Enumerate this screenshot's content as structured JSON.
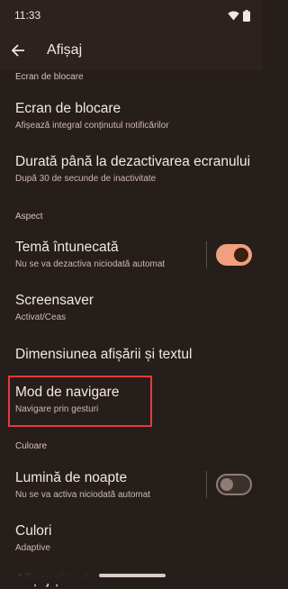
{
  "status": {
    "time": "11:33"
  },
  "appbar": {
    "title": "Afișaj"
  },
  "sections": {
    "lock": "Ecran de blocare",
    "aspect": "Aspect",
    "culoare": "Culoare"
  },
  "items": {
    "lockscreen": {
      "title": "Ecran de blocare",
      "sub": "Afișează integral conținutul notificărilor"
    },
    "timeout": {
      "title": "Durată până la dezactivarea ecranului",
      "sub": "După 30 de secunde de inactivitate"
    },
    "dark": {
      "title": "Temă întunecată",
      "sub": "Nu se va dezactiva niciodată automat",
      "enabled": true
    },
    "screensaver": {
      "title": "Screensaver",
      "sub": "Activat/Ceas"
    },
    "size": {
      "title": "Dimensiunea afișării și textul"
    },
    "nav": {
      "title": "Mod de navigare",
      "sub": "Navigare prin gesturi"
    },
    "night": {
      "title": "Lumină de noapte",
      "sub": "Nu se va activa niciodată automat",
      "enabled": false
    },
    "colors": {
      "title": "Culori",
      "sub": "Adaptive"
    },
    "partial": {
      "title": "Afișaj și text"
    }
  },
  "colors": {
    "accent": "#f0a07e",
    "background": "#261e1b",
    "highlight": "#e53a3a"
  }
}
